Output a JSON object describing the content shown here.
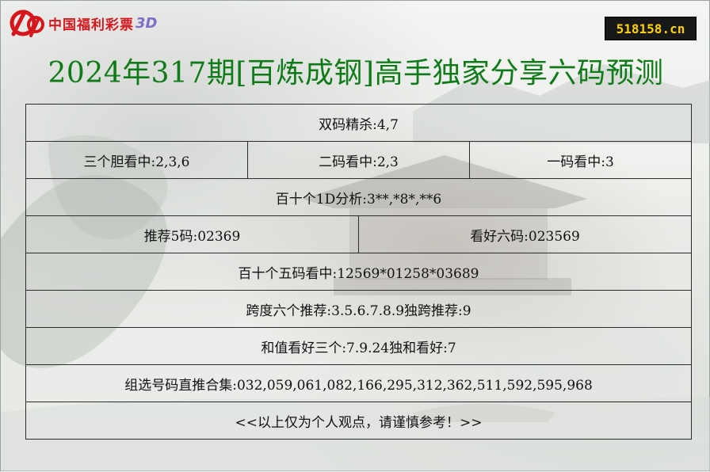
{
  "logo": {
    "text": "中国福利彩票",
    "suffix": "3D"
  },
  "site": {
    "label": "518158.cn"
  },
  "title": "2024年317期[百炼成钢]高手独家分享六码预测",
  "rows": {
    "r1": "双码精杀:4,7",
    "r2": [
      "三个胆看中:2,3,6",
      "二码看中:2,3",
      "一码看中:3"
    ],
    "r3": "百十个1D分析:3**,*8*,**6",
    "r4": [
      "推荐5码:02369",
      "看好六码:023569"
    ],
    "r5": "百十个五码看中:12569*01258*03689",
    "r6": "跨度六个推荐:3.5.6.7.8.9独跨推荐:9",
    "r7": "和值看好三个:7.9.24独和看好:7",
    "r8": "组选号码直推合集:032,059,061,082,166,295,312,362,511,592,595,968",
    "r9": "<<以上仅为个人观点，请谨慎参考！>>"
  },
  "colors": {
    "title": "#0f7a18",
    "logo_red": "#d6161d",
    "badge_bg": "#181818",
    "badge_text": "#ffd200",
    "border": "#2b2b2b"
  }
}
